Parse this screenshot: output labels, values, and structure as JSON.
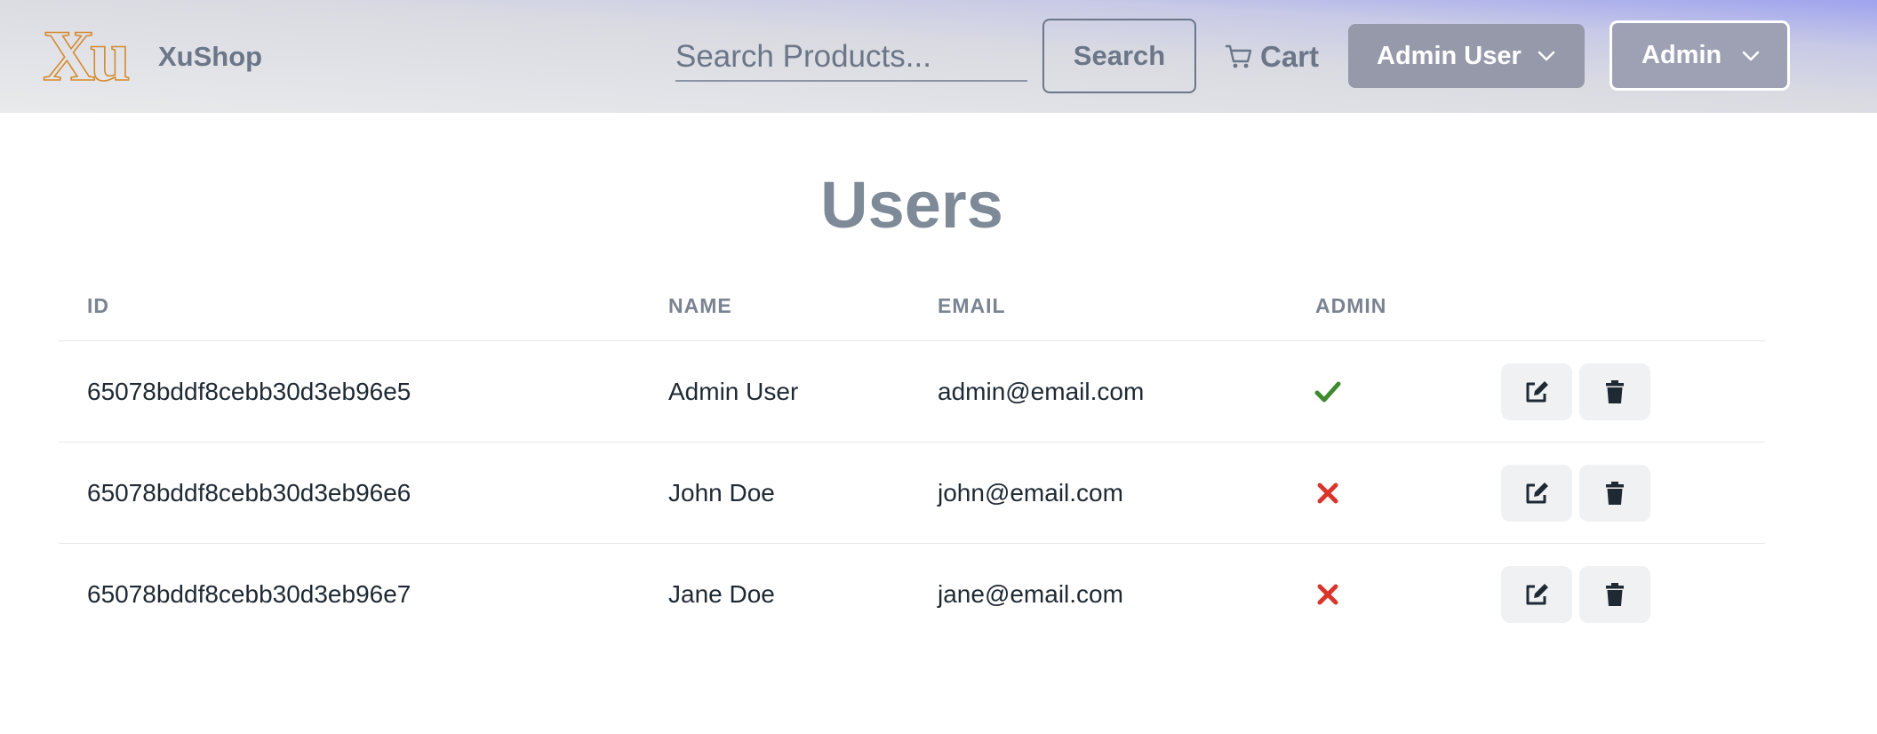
{
  "header": {
    "brand": "XuShop",
    "logo_text": "Xu",
    "search": {
      "placeholder": "Search Products..."
    },
    "search_button": "Search",
    "cart_label": "Cart",
    "user_menu_label": "Admin User",
    "admin_menu_label": "Admin"
  },
  "page": {
    "title": "Users",
    "columns": [
      "ID",
      "NAME",
      "EMAIL",
      "ADMIN"
    ],
    "rows": [
      {
        "id": "65078bddf8cebb30d3eb96e5",
        "name": "Admin User",
        "email": "admin@email.com",
        "is_admin": true
      },
      {
        "id": "65078bddf8cebb30d3eb96e6",
        "name": "John Doe",
        "email": "john@email.com",
        "is_admin": false
      },
      {
        "id": "65078bddf8cebb30d3eb96e7",
        "name": "Jane Doe",
        "email": "jane@email.com",
        "is_admin": false
      }
    ]
  },
  "icons": {
    "logo": "xu-logo-icon",
    "cart": "cart-icon",
    "chevron": "chevron-down-icon",
    "admin_true": "check-icon",
    "admin_false": "x-icon",
    "edit": "edit-icon",
    "delete": "trash-icon"
  },
  "colors": {
    "check": "#3d8a2f",
    "cross": "#d9352a",
    "logo": "#d48a2f"
  }
}
